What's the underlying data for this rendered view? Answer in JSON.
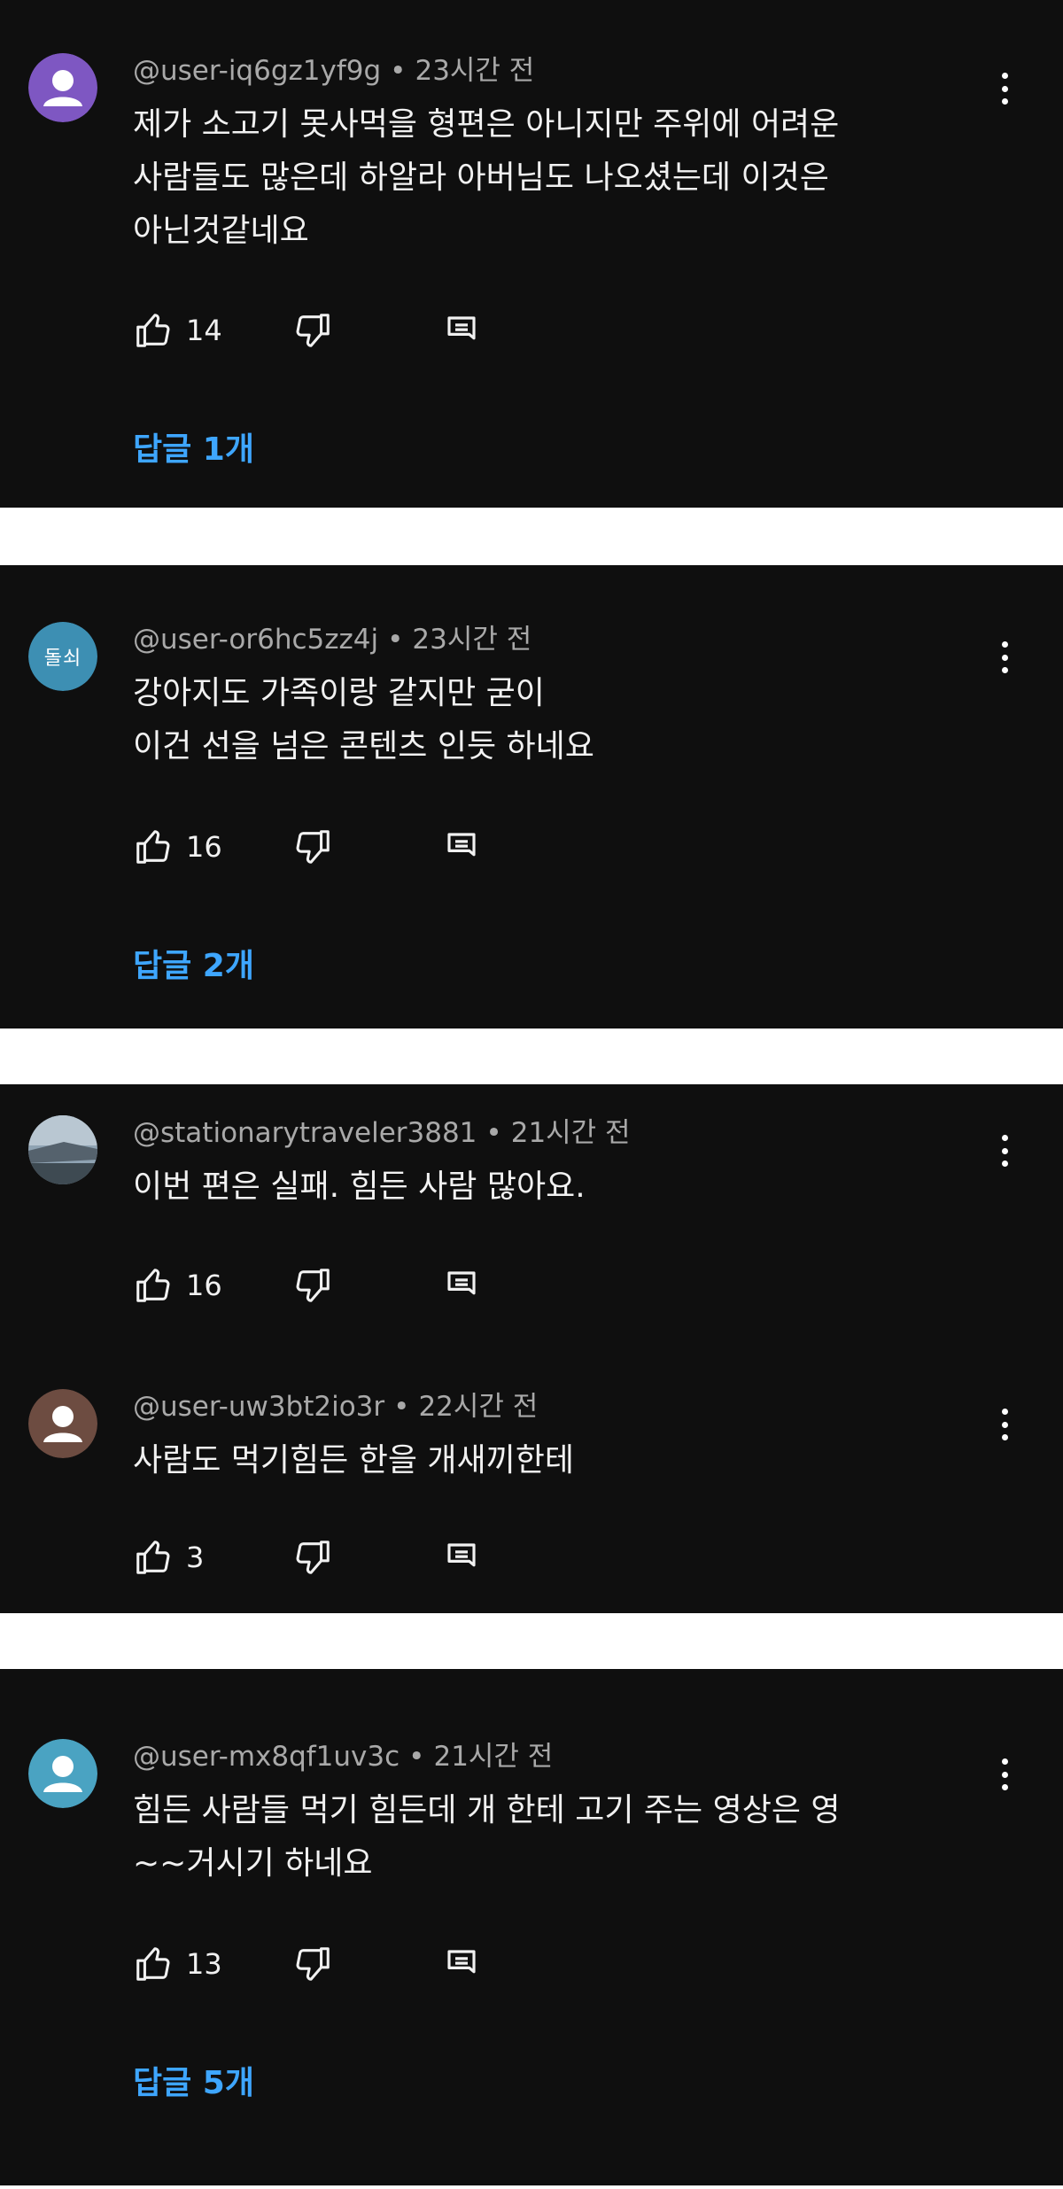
{
  "colors": {
    "card_bg": "#0f0f0f",
    "text": "#f1f1f1",
    "meta": "#a9a9a9",
    "link": "#3ea6ff"
  },
  "comments": [
    {
      "handle": "@user-iq6gz1yf9g",
      "separator": "•",
      "time": "23시간 전",
      "avatar": {
        "type": "person-icon",
        "color": "#7e57c2"
      },
      "lines": [
        "제가 소고기 못사먹을 형편은 아니지만 주위에 어려운",
        "사람들도 많은데 하알라  아버님도 나오셨는데 이것은",
        "아닌것같네요"
      ],
      "likes": "14",
      "replies_label": "답글 1개"
    },
    {
      "handle": "@user-or6hc5zz4j",
      "separator": "•",
      "time": "23시간 전",
      "avatar": {
        "type": "initials",
        "text": "돌쇠",
        "color": "#3d8fb3"
      },
      "lines": [
        "강아지도 가족이랑 같지만 굳이",
        "이건 선을 넘은 콘텐츠 인듯 하네요"
      ],
      "likes": "16",
      "replies_label": "답글 2개"
    },
    {
      "handle": "@stationarytraveler3881",
      "separator": "•",
      "time": "21시간 전",
      "avatar": {
        "type": "landscape-photo",
        "color": "#6b7b88"
      },
      "lines": [
        "이번 편은 실패. 힘든 사람 많아요."
      ],
      "likes": "16"
    },
    {
      "handle": "@user-uw3bt2io3r",
      "separator": "•",
      "time": "22시간 전",
      "avatar": {
        "type": "person-icon",
        "color": "#6d4c41"
      },
      "lines": [
        "사람도 먹기힘든 한을 개새끼한테"
      ],
      "likes": "3"
    },
    {
      "handle": "@user-mx8qf1uv3c",
      "separator": "•",
      "time": "21시간 전",
      "avatar": {
        "type": "person-icon",
        "color": "#4aa3c2"
      },
      "lines": [
        "힘든 사람들 먹기 힘든데 개 한테 고기 주는 영상은 영",
        "~~거시기 하네요"
      ],
      "likes": "13",
      "replies_label": "답글 5개"
    }
  ],
  "icons": {
    "like": "thumb-up-icon",
    "dislike": "thumb-down-icon",
    "reply": "comment-icon",
    "more": "more-vert-icon"
  }
}
